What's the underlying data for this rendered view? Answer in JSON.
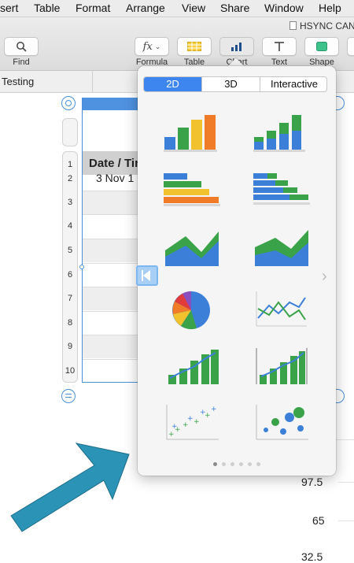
{
  "menubar": {
    "items": [
      "sert",
      "Table",
      "Format",
      "Arrange",
      "View",
      "Share",
      "Window",
      "Help"
    ]
  },
  "document": {
    "title": "HSYNC CAN"
  },
  "toolbar": {
    "find_label": "Find",
    "formula_label": "Formula",
    "formula_glyph": "fx",
    "table_label": "Table",
    "chart_label": "Chart",
    "text_label": "Text",
    "shape_label": "Shape"
  },
  "sheet": {
    "tab_name": "Testing"
  },
  "table": {
    "header": "Date / Tir",
    "first_value": "3 Nov 1",
    "row_numbers": [
      "1",
      "2",
      "3",
      "4",
      "5",
      "6",
      "7",
      "8",
      "9",
      "10"
    ]
  },
  "axis_values": [
    "97.5",
    "65",
    "32.5"
  ],
  "chart_popover": {
    "segments": [
      "2D",
      "3D",
      "Interactive"
    ],
    "active_segment": "2D",
    "chart_types": [
      "column",
      "stacked-column",
      "bar",
      "stacked-bar",
      "area",
      "stacked-area",
      "pie",
      "line",
      "mixed",
      "two-axis",
      "scatter",
      "bubble"
    ],
    "page_count": 6,
    "active_page": 1
  },
  "colors": {
    "accent": "#3d86f0",
    "arrow": "#2b93b6",
    "blue": "#3b7fd9",
    "green": "#3aa34a",
    "orange": "#f07c2a",
    "yellow": "#f2c12e"
  }
}
